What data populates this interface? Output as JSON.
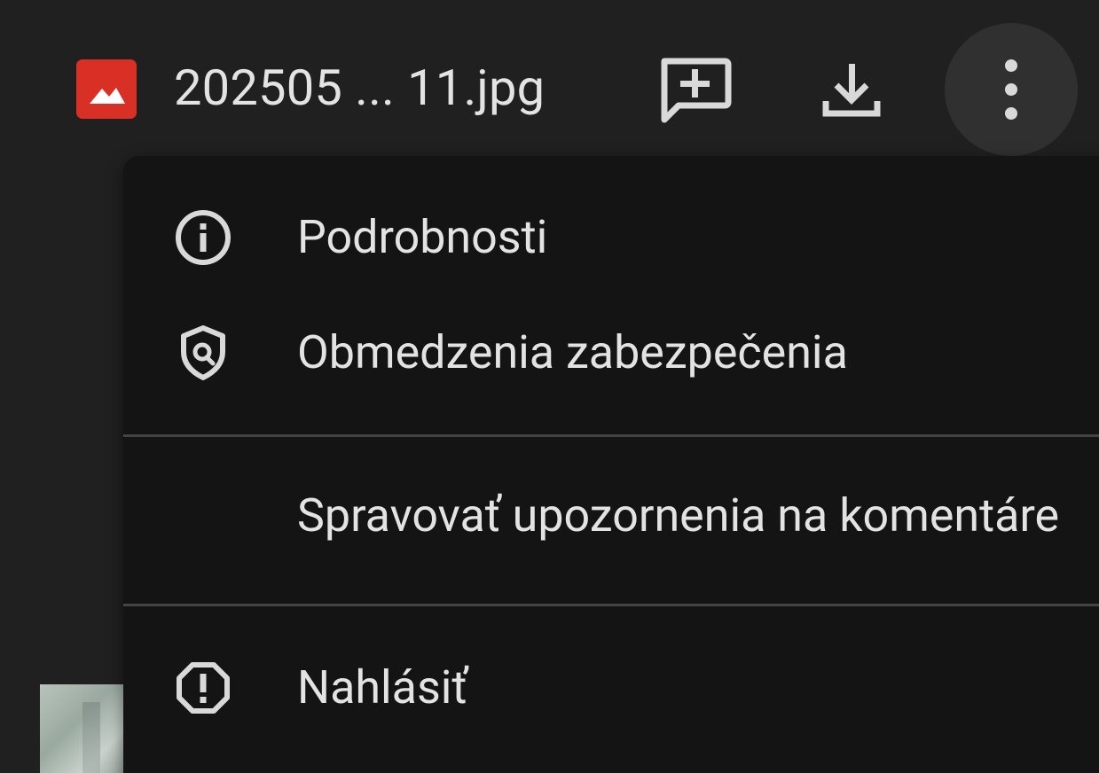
{
  "header": {
    "file_name": "202505 ... 11.jpg",
    "file_type_icon": "image-file-icon",
    "actions": [
      {
        "name": "add-comment",
        "icon": "add-comment-icon"
      },
      {
        "name": "download",
        "icon": "download-icon"
      },
      {
        "name": "more-options",
        "icon": "more-vert-icon"
      }
    ]
  },
  "menu": {
    "items": [
      {
        "label": "Podrobnosti",
        "icon": "info-icon"
      },
      {
        "label": "Obmedzenia zabezpečenia",
        "icon": "security-shield-icon"
      },
      {
        "label": "Spravovať upozornenia na komentáre",
        "icon": ""
      },
      {
        "label": "Nahlásiť",
        "icon": "report-icon"
      }
    ]
  },
  "colors": {
    "background": "#202020",
    "menu_background": "#141414",
    "text": "#e3e3e3",
    "icon": "#d9d9d9",
    "file_icon_red": "#d93025",
    "more_button_bg": "#303030",
    "divider": "#444444"
  }
}
